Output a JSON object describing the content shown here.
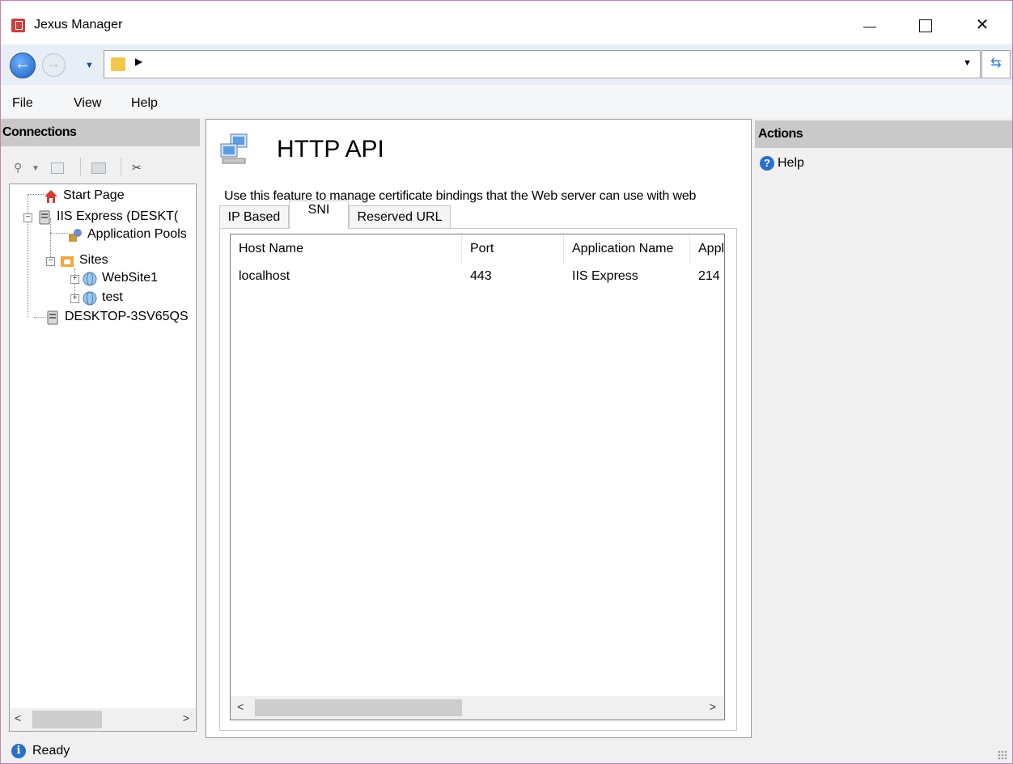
{
  "window": {
    "title": "Jexus Manager"
  },
  "menu": {
    "items": [
      "File",
      "View",
      "Help"
    ]
  },
  "connections": {
    "header": "Connections",
    "tree": [
      {
        "label": "Start Page",
        "icon": "home-icon"
      },
      {
        "label": "IIS Express (DESKT(",
        "icon": "server-icon"
      },
      {
        "label": "Application Pools",
        "icon": "app-pools-icon"
      },
      {
        "label": "Sites",
        "icon": "sites-folder-icon"
      },
      {
        "label": "WebSite1",
        "icon": "globe-icon"
      },
      {
        "label": "test",
        "icon": "globe-icon"
      },
      {
        "label": "DESKTOP-3SV65QS",
        "icon": "server-icon"
      }
    ]
  },
  "main": {
    "title": "HTTP API",
    "description": "Use this feature to manage certificate bindings that the Web server can use with web",
    "tabs": [
      "IP Based",
      "SNI",
      "Reserved URL"
    ],
    "active_tab": "SNI",
    "table": {
      "columns": [
        "Host Name",
        "Port",
        "Application Name",
        "Appl"
      ],
      "rows": [
        [
          "localhost",
          "443",
          "IIS Express",
          "214"
        ]
      ]
    }
  },
  "actions": {
    "header": "Actions",
    "help": "Help"
  },
  "status": {
    "text": "Ready"
  },
  "colors": {
    "accent": "#2c6fc9",
    "panel_header": "#c9c9c9",
    "window_border": "#c77fb0"
  }
}
